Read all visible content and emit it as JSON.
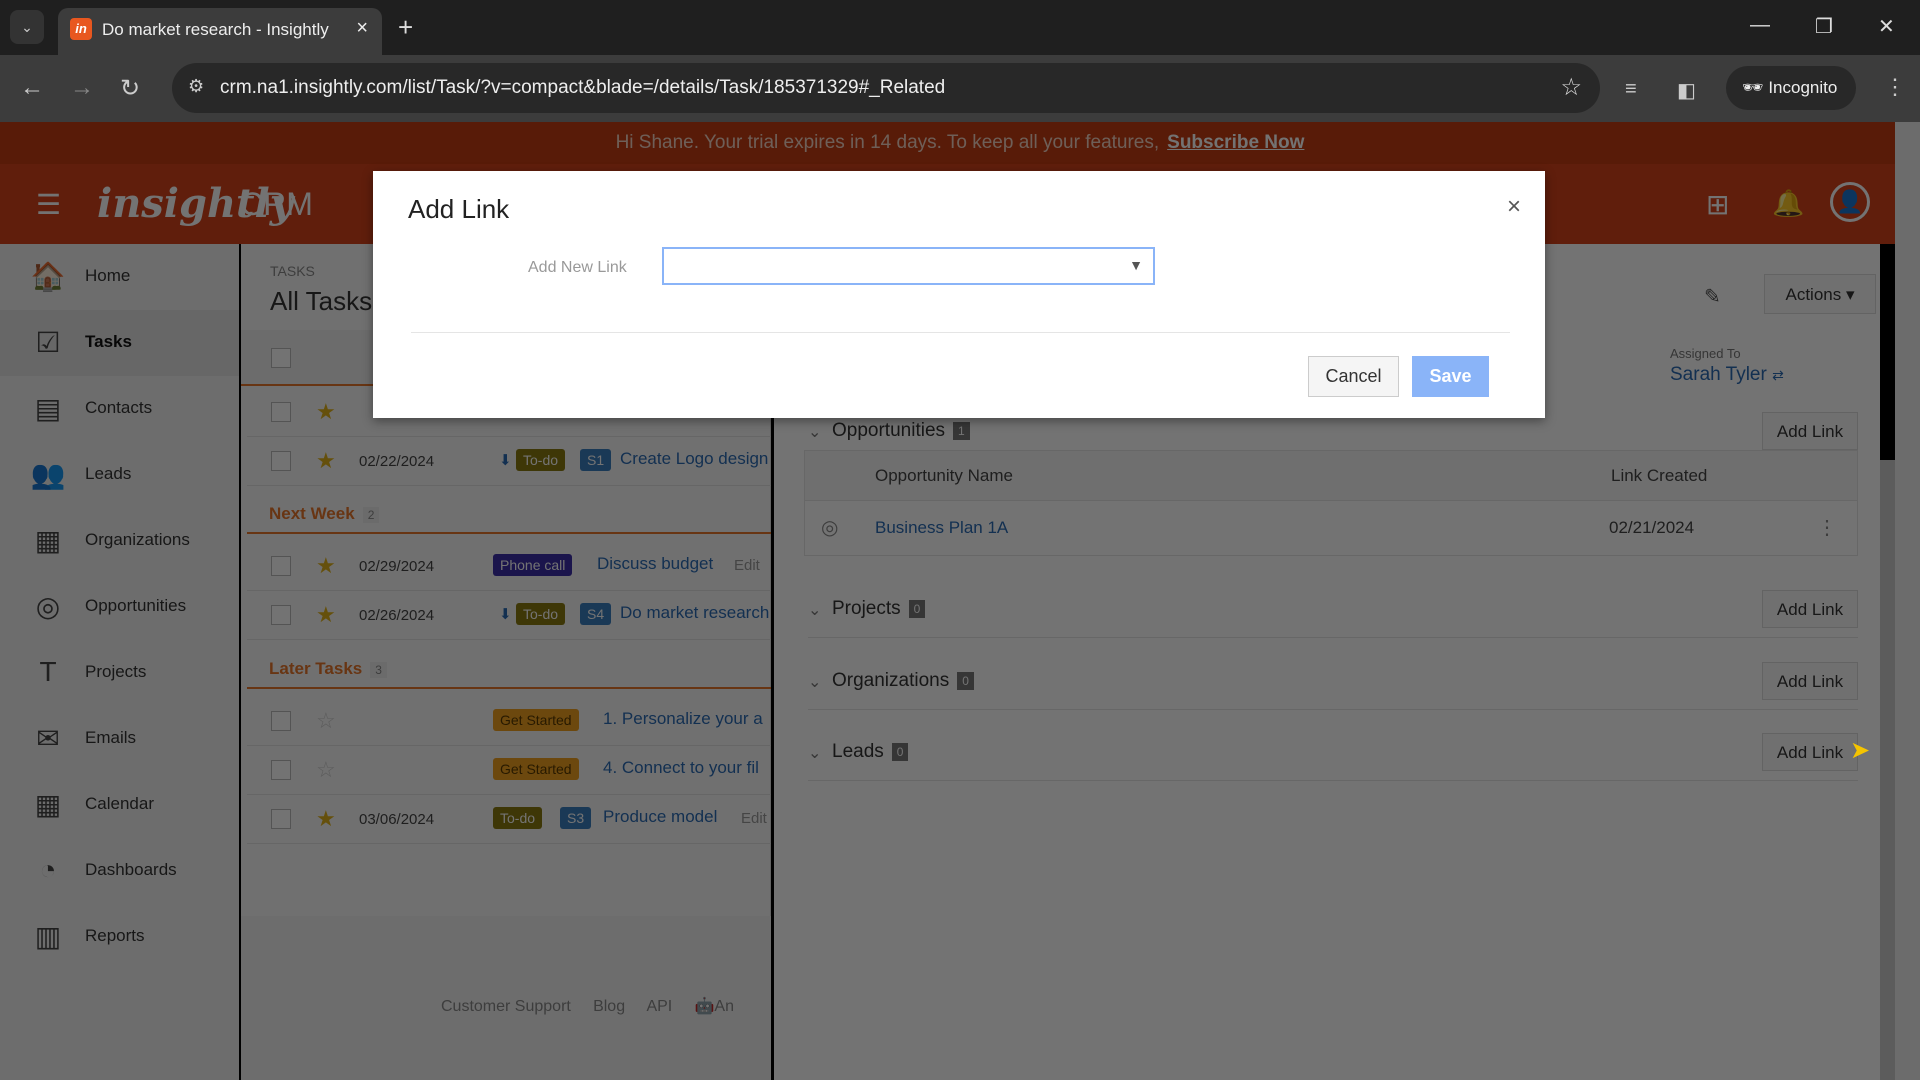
{
  "browser": {
    "tab_title": "Do market research - Insightly",
    "url": "crm.na1.insightly.com/list/Task/?v=compact&blade=/details/Task/185371329#_Related",
    "incognito_label": "Incognito"
  },
  "banner": {
    "text": "Hi Shane. Your trial expires in 14 days. To keep all your features,",
    "link": "Subscribe Now"
  },
  "header": {
    "logo": "insightly",
    "product": "CRM"
  },
  "sidebar": {
    "items": [
      {
        "label": "Home",
        "icon": "🏠"
      },
      {
        "label": "Tasks",
        "icon": "☑"
      },
      {
        "label": "Contacts",
        "icon": "▤"
      },
      {
        "label": "Leads",
        "icon": "👥"
      },
      {
        "label": "Organizations",
        "icon": "▦"
      },
      {
        "label": "Opportunities",
        "icon": "◎"
      },
      {
        "label": "Projects",
        "icon": "T"
      },
      {
        "label": "Emails",
        "icon": "✉"
      },
      {
        "label": "Calendar",
        "icon": "▦"
      },
      {
        "label": "Dashboards",
        "icon": "◔"
      },
      {
        "label": "Reports",
        "icon": "▥"
      }
    ]
  },
  "tasks": {
    "breadcrumb": "TASKS",
    "title": "All Tasks",
    "rows": [
      {
        "date": "02/22/2024",
        "status": "To-do",
        "tag": "S1",
        "title": "Create Logo design",
        "starred": true
      },
      {
        "date": "02/29/2024",
        "status": "Phone call",
        "title": "Discuss budget",
        "extra": "Edit",
        "starred": true
      },
      {
        "date": "02/26/2024",
        "status": "To-do",
        "tag": "S4",
        "title": "Do market research",
        "starred": true
      },
      {
        "date": "",
        "status": "Get Started",
        "title": "1. Personalize your a",
        "starred": false
      },
      {
        "date": "",
        "status": "Get Started",
        "title": "4. Connect to your fil",
        "starred": false
      },
      {
        "date": "03/06/2024",
        "status": "To-do",
        "tag": "S3",
        "title": "Produce model",
        "extra": "Edit",
        "starred": true
      }
    ],
    "groups": [
      {
        "label": "Next Week",
        "count": "2"
      },
      {
        "label": "Later Tasks",
        "count": "3"
      }
    ]
  },
  "footer": {
    "links": [
      "Customer Support",
      "Blog",
      "API",
      "An"
    ]
  },
  "details": {
    "actions_label": "Actions",
    "assigned_to_label": "Assigned To",
    "assigned_to": "Sarah Tyler",
    "sections": [
      {
        "name": "Opportunities",
        "count": "1"
      },
      {
        "name": "Projects",
        "count": "0"
      },
      {
        "name": "Organizations",
        "count": "0"
      },
      {
        "name": "Leads",
        "count": "0"
      }
    ],
    "add_link_label": "Add Link",
    "opp_table": {
      "headers": [
        "Opportunity Name",
        "Link Created"
      ],
      "rows": [
        {
          "name": "Business Plan 1A",
          "created": "02/21/2024"
        }
      ]
    }
  },
  "modal": {
    "title": "Add Link",
    "field_label": "Add New Link",
    "field_value": "",
    "cancel": "Cancel",
    "save": "Save"
  },
  "colors": {
    "brand": "#d5431b",
    "banner": "#c43d12",
    "todo": "#8a7a10",
    "phone": "#3b2fa8",
    "get_started": "#f0a020",
    "tag": "#3a7fbf",
    "save": "#8ab4f8"
  }
}
